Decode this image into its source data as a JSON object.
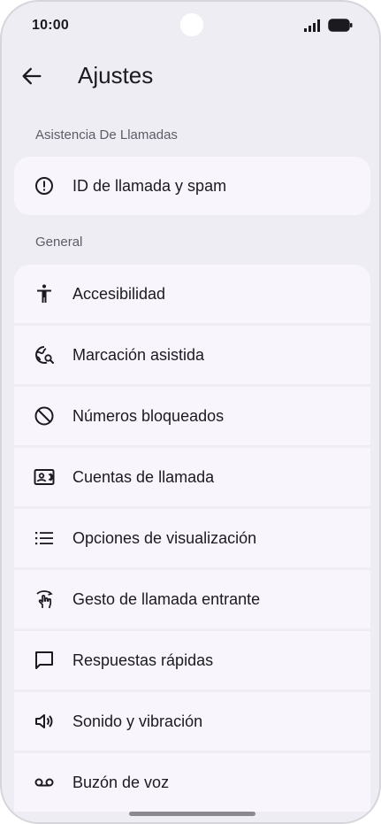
{
  "status_bar": {
    "time": "10:00"
  },
  "app_bar": {
    "title": "Ajustes"
  },
  "sections": [
    {
      "label": "Asistencia De Llamadas",
      "items": [
        {
          "label": "ID de llamada y spam",
          "icon": "alert-circle-icon"
        }
      ]
    },
    {
      "label": "General",
      "items": [
        {
          "label": "Accesibilidad",
          "icon": "accessibility-icon"
        },
        {
          "label": "Marcación asistida",
          "icon": "globe-search-icon"
        },
        {
          "label": "Números bloqueados",
          "icon": "block-icon"
        },
        {
          "label": "Cuentas de llamada",
          "icon": "contact-card-icon"
        },
        {
          "label": "Opciones de visualización",
          "icon": "list-icon"
        },
        {
          "label": "Gesto de llamada entrante",
          "icon": "gesture-icon"
        },
        {
          "label": "Respuestas rápidas",
          "icon": "chat-bubble-icon"
        },
        {
          "label": "Sonido y vibración",
          "icon": "volume-icon"
        },
        {
          "label": "Buzón de voz",
          "icon": "voicemail-icon"
        }
      ]
    }
  ],
  "colors": {
    "background": "#efedf4",
    "card": "#f8f6fc",
    "text": "#1b1b1f",
    "secondary_text": "#5d5b66"
  }
}
